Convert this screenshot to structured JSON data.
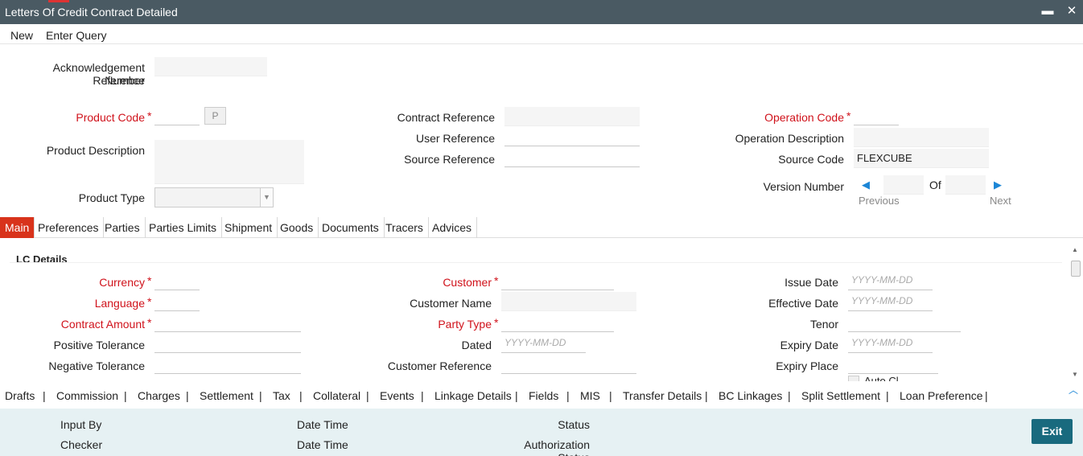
{
  "window": {
    "title": "Letters Of Credit Contract Detailed",
    "minimize_glyph": "▬",
    "close_glyph": "✕"
  },
  "menu": {
    "new": "New",
    "enter_query": "Enter Query"
  },
  "header": {
    "ack_ref_label_1": "Acknowledgement Reference",
    "ack_ref_label_2": "Number",
    "product_code_label": "Product Code",
    "product_code_button": "P",
    "product_description_label": "Product Description",
    "product_type_label": "Product Type",
    "contract_reference_label": "Contract Reference",
    "user_reference_label": "User Reference",
    "source_reference_label": "Source Reference",
    "operation_code_label": "Operation Code",
    "operation_description_label": "Operation Description",
    "source_code_label": "Source Code",
    "source_code_value": "FLEXCUBE",
    "version_number_label": "Version Number",
    "of_label": "Of",
    "previous_label": "Previous",
    "next_label": "Next",
    "required_mark": "*"
  },
  "tabs": [
    "Main",
    "Preferences",
    "Parties",
    "Parties Limits",
    "Shipment",
    "Goods",
    "Documents",
    "Tracers",
    "Advices"
  ],
  "lc_details": {
    "title": "LC Details",
    "currency_label": "Currency",
    "language_label": "Language",
    "contract_amount_label": "Contract Amount",
    "positive_tolerance_label": "Positive Tolerance",
    "negative_tolerance_label": "Negative Tolerance",
    "customer_label": "Customer",
    "customer_name_label": "Customer Name",
    "party_type_label": "Party Type",
    "dated_label": "Dated",
    "customer_reference_label": "Customer Reference",
    "issue_date_label": "Issue Date",
    "effective_date_label": "Effective Date",
    "tenor_label": "Tenor",
    "expiry_date_label": "Expiry Date",
    "expiry_place_label": "Expiry Place",
    "auto_close_partial": "Auto Cl",
    "date_placeholder": "YYYY-MM-DD"
  },
  "bottom_links": [
    "Drafts",
    "Commission",
    "Charges",
    "Settlement",
    "Tax",
    "Collateral",
    "Events",
    "Linkage Details",
    "Fields",
    "MIS",
    "Transfer Details",
    "BC Linkages",
    "Split Settlement",
    "Loan Preference"
  ],
  "bottom_separator": "|",
  "footer": {
    "input_by": "Input By",
    "checker": "Checker",
    "date_time_1": "Date Time",
    "date_time_2": "Date Time",
    "status": "Status",
    "authorization_status": "Authorization Status",
    "exit": "Exit"
  },
  "colors": {
    "title_bar": "#4a5a63",
    "required": "#d0121b",
    "active_tab": "#d8331b",
    "link_blue": "#1c86d6",
    "exit_button": "#196a7e",
    "footer_bg": "#e6f1f3"
  },
  "icons": {
    "previous": "arrow-left-icon",
    "next": "arrow-right-icon",
    "collapse": "chevron-up-icon",
    "dropdown": "chevron-down-icon"
  }
}
